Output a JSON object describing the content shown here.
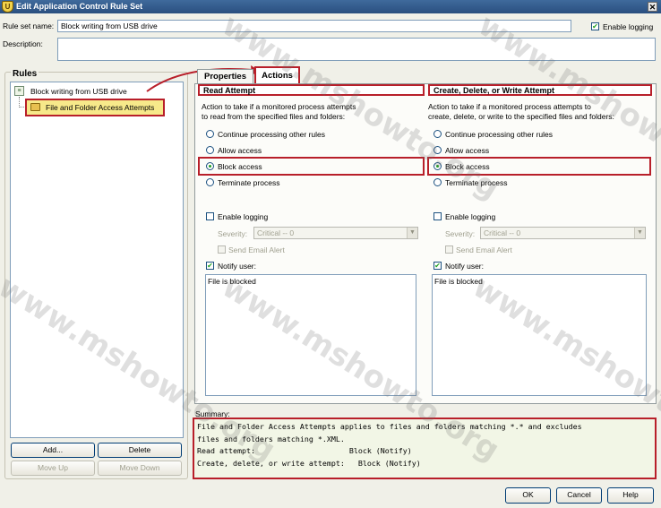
{
  "window": {
    "title": "Edit Application Control Rule Set"
  },
  "header": {
    "rule_set_name_label": "Rule set name:",
    "rule_set_name_value": "Block writing from USB drive",
    "enable_logging_label": "Enable logging",
    "description_label": "Description:",
    "description_value": ""
  },
  "rules_panel": {
    "title": "Rules",
    "tree_root": "Block writing from USB drive",
    "tree_child": "File and Folder Access Attempts",
    "add_button": "Add...",
    "delete_button": "Delete",
    "move_up_button": "Move Up",
    "move_down_button": "Move Down"
  },
  "tabs": {
    "properties": "Properties",
    "actions": "Actions"
  },
  "read_attempt": {
    "title": "Read Attempt",
    "desc_line1": "Action to take if a monitored process attempts",
    "desc_line2": "to read from the specified files and folders:",
    "opt_continue": "Continue processing other rules",
    "opt_allow": "Allow access",
    "opt_block": "Block access",
    "opt_terminate": "Terminate process",
    "enable_logging": "Enable logging",
    "severity_label": "Severity:",
    "severity_value": "Critical -- 0",
    "send_email": "Send Email Alert",
    "notify_user": "Notify user:",
    "notify_text": "File is blocked"
  },
  "write_attempt": {
    "title": "Create, Delete, or Write Attempt",
    "desc_line1": "Action to take if a monitored process attempts to",
    "desc_line2": "create, delete, or write to the specified files and folders:",
    "opt_continue": "Continue processing other rules",
    "opt_allow": "Allow access",
    "opt_block": "Block access",
    "opt_terminate": "Terminate process",
    "enable_logging": "Enable logging",
    "severity_label": "Severity:",
    "severity_value": "Critical -- 0",
    "send_email": "Send Email Alert",
    "notify_user": "Notify user:",
    "notify_text": "File is blocked"
  },
  "summary": {
    "label": "Summary:",
    "line1": "File and Folder Access Attempts applies to files and folders matching *.* and excludes",
    "line2": "files and folders matching *.XML.",
    "line3": "Read attempt:                     Block (Notify)",
    "line4": "Create, delete, or write attempt:   Block (Notify)"
  },
  "footer": {
    "ok": "OK",
    "cancel": "Cancel",
    "help": "Help"
  },
  "watermark": {
    "text": "www.mshowto.org"
  },
  "colors": {
    "highlight_red": "#b81f2a",
    "title_blue": "#2a4f7f",
    "window_bg": "#f0f0e8"
  }
}
